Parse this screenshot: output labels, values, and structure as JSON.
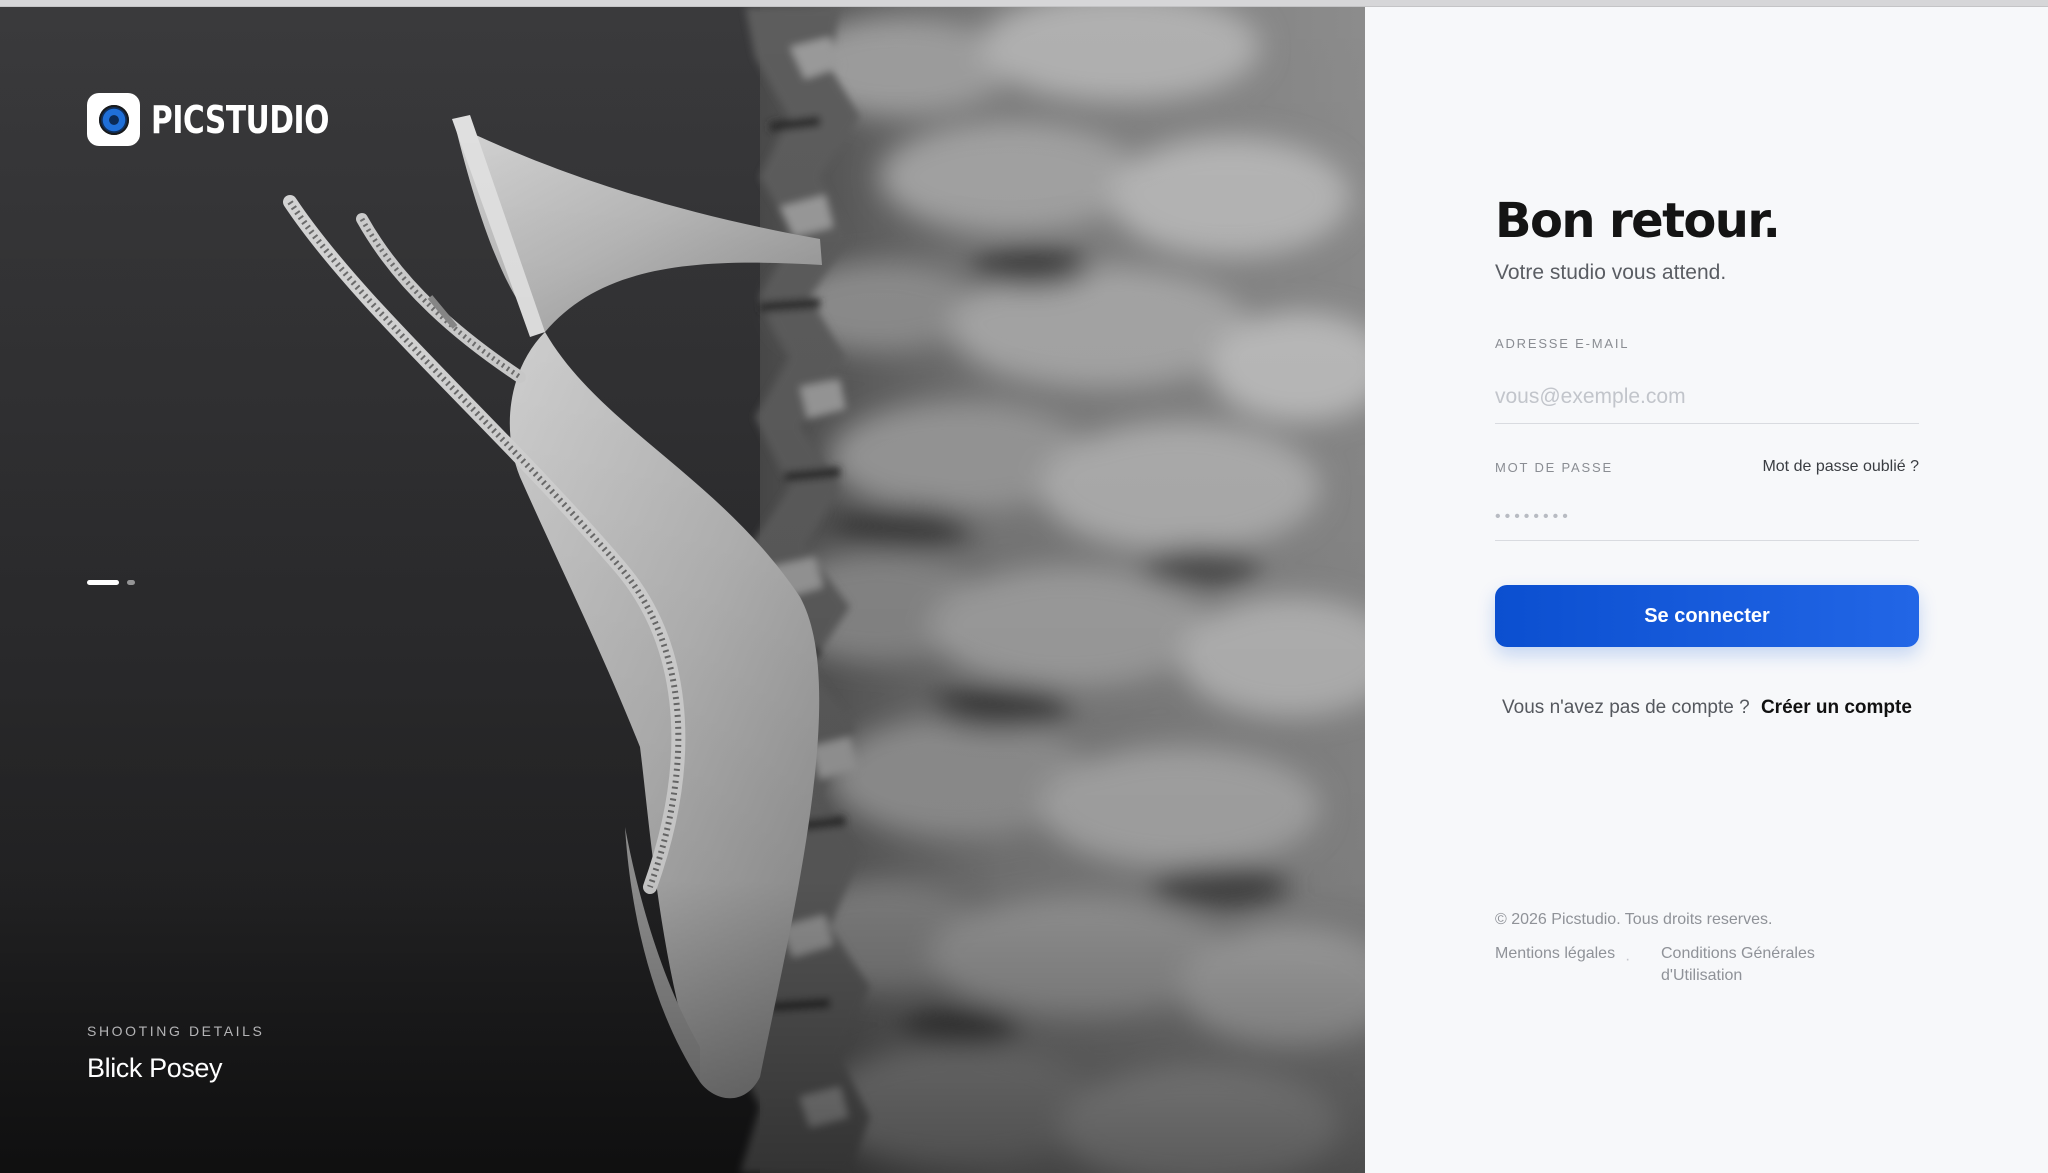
{
  "brand": {
    "name": "PICSTUDIO",
    "logo_icon": "camera-lens-icon"
  },
  "hero": {
    "slides_total": 2,
    "active_slide": 1,
    "credit_label": "SHOOTING DETAILS",
    "credit_name": "Blick Posey"
  },
  "login": {
    "title": "Bon retour.",
    "subtitle": "Votre studio vous attend.",
    "email_label": "ADRESSE E-MAIL",
    "email_placeholder": "vous@exemple.com",
    "password_label": "MOT DE PASSE",
    "password_placeholder": "••••••••",
    "forgot_link": "Mot de passe oublié ?",
    "submit_label": "Se connecter",
    "no_account_text": "Vous n'avez pas de compte ?",
    "create_account_link": "Créer un compte"
  },
  "footer": {
    "copyright": "© 2026 Picstudio. Tous droits reserves.",
    "legal_link": "Mentions légales",
    "separator": "·",
    "terms_link": "Conditions Générales d'Utilisation"
  },
  "colors": {
    "accent": "#1a5fe0",
    "panel_bg": "#f7f8fa",
    "title": "#141414"
  }
}
